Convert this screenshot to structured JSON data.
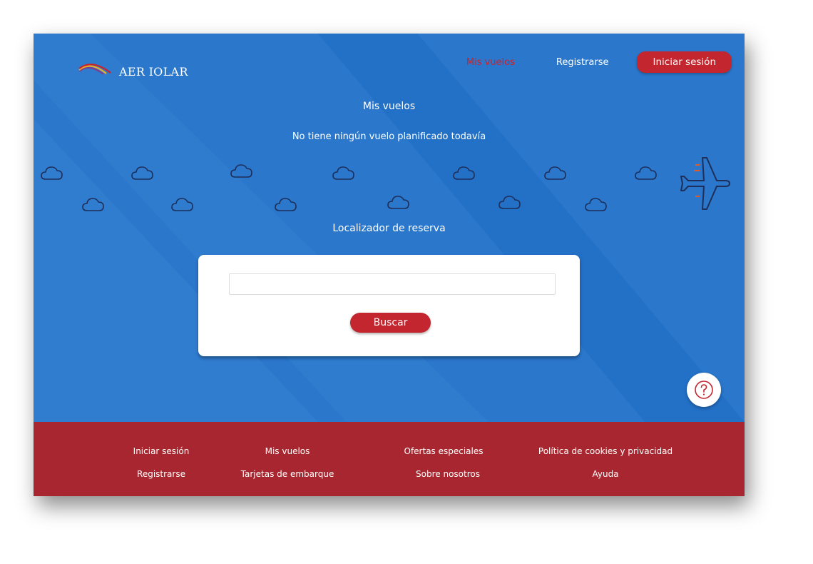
{
  "brand": {
    "name": "AER IOLAR",
    "logo_icon": "wing-stripes-logo",
    "colors": {
      "stripe_1": "#c8232c",
      "stripe_2": "#e8b028",
      "stripe_3": "#7a3f8f"
    }
  },
  "header": {
    "nav": {
      "my_flights": "Mis vuelos",
      "register": "Registrarse",
      "login": "Iniciar sesión"
    }
  },
  "main": {
    "title": "Mis vuelos",
    "empty_message": "No tiene ningún vuelo planificado todavía",
    "locator_label": "Localizador de reserva",
    "search": {
      "value": "",
      "placeholder": "",
      "button": "Buscar"
    }
  },
  "decor": {
    "cloud_icon": "cloud-icon",
    "plane_icon": "airplane-icon"
  },
  "help": {
    "icon": "question-mark-icon"
  },
  "footer": {
    "columns": [
      [
        "Iniciar sesión",
        "Registrarse"
      ],
      [
        "Mis vuelos",
        "Tarjetas de embarque"
      ],
      [
        "Ofertas especiales",
        "Sobre nosotros"
      ],
      [
        "Política de cookies y privacidad",
        "Ayuda"
      ]
    ]
  },
  "colors": {
    "hero_blue": "#2a77cb",
    "accent_red": "#c3262e",
    "footer_red": "#a8262f",
    "text_white": "#ffffff"
  }
}
